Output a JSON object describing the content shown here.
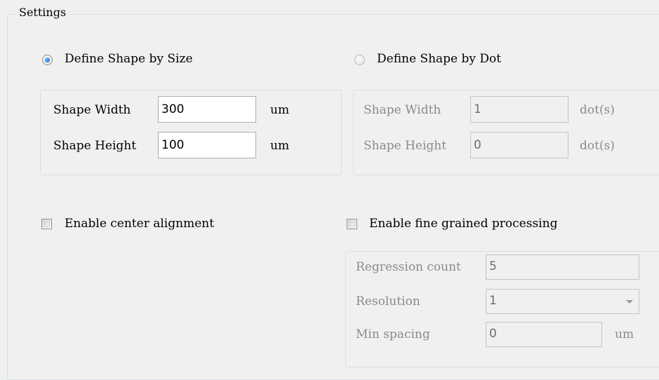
{
  "settings": {
    "title": "Settings",
    "by_size": {
      "radio_label": "Define Shape by Size",
      "selected": true,
      "width_label": "Shape Width",
      "width_value": "300",
      "width_unit": "um",
      "height_label": "Shape Height",
      "height_value": "100",
      "height_unit": "um"
    },
    "by_dot": {
      "radio_label": "Define Shape by Dot",
      "selected": false,
      "width_label": "Shape Width",
      "width_value": "1",
      "width_unit": "dot(s)",
      "height_label": "Shape Height",
      "height_value": "0",
      "height_unit": "dot(s)"
    },
    "center_alignment": {
      "label": "Enable center alignment",
      "checked": false
    },
    "fine_grained": {
      "label": "Enable fine grained processing",
      "checked": false,
      "regression_label": "Regression count",
      "regression_value": "5",
      "resolution_label": "Resolution",
      "resolution_value": "1",
      "min_spacing_label": "Min spacing",
      "min_spacing_value": "0",
      "min_spacing_unit": "um"
    }
  },
  "icons": {
    "dropdown": "chevron-down-icon"
  }
}
